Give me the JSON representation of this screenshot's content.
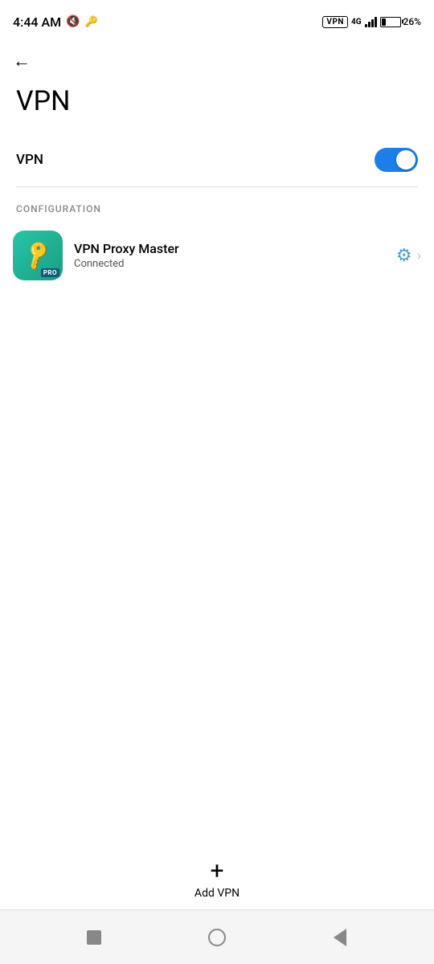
{
  "statusBar": {
    "time": "4:44 AM",
    "vpnBadge": "VPN",
    "signal4g": "4G",
    "batteryPercent": "26%"
  },
  "header": {
    "backLabel": "←",
    "title": "VPN"
  },
  "vpnToggle": {
    "label": "VPN",
    "isOn": true
  },
  "configuration": {
    "sectionLabel": "CONFIGURATION",
    "item": {
      "appName": "VPN Proxy Master",
      "status": "Connected",
      "proBadge": "PRO"
    }
  },
  "addVpn": {
    "icon": "+",
    "label": "Add VPN"
  },
  "navbar": {
    "square": "",
    "circle": "",
    "triangle": ""
  }
}
